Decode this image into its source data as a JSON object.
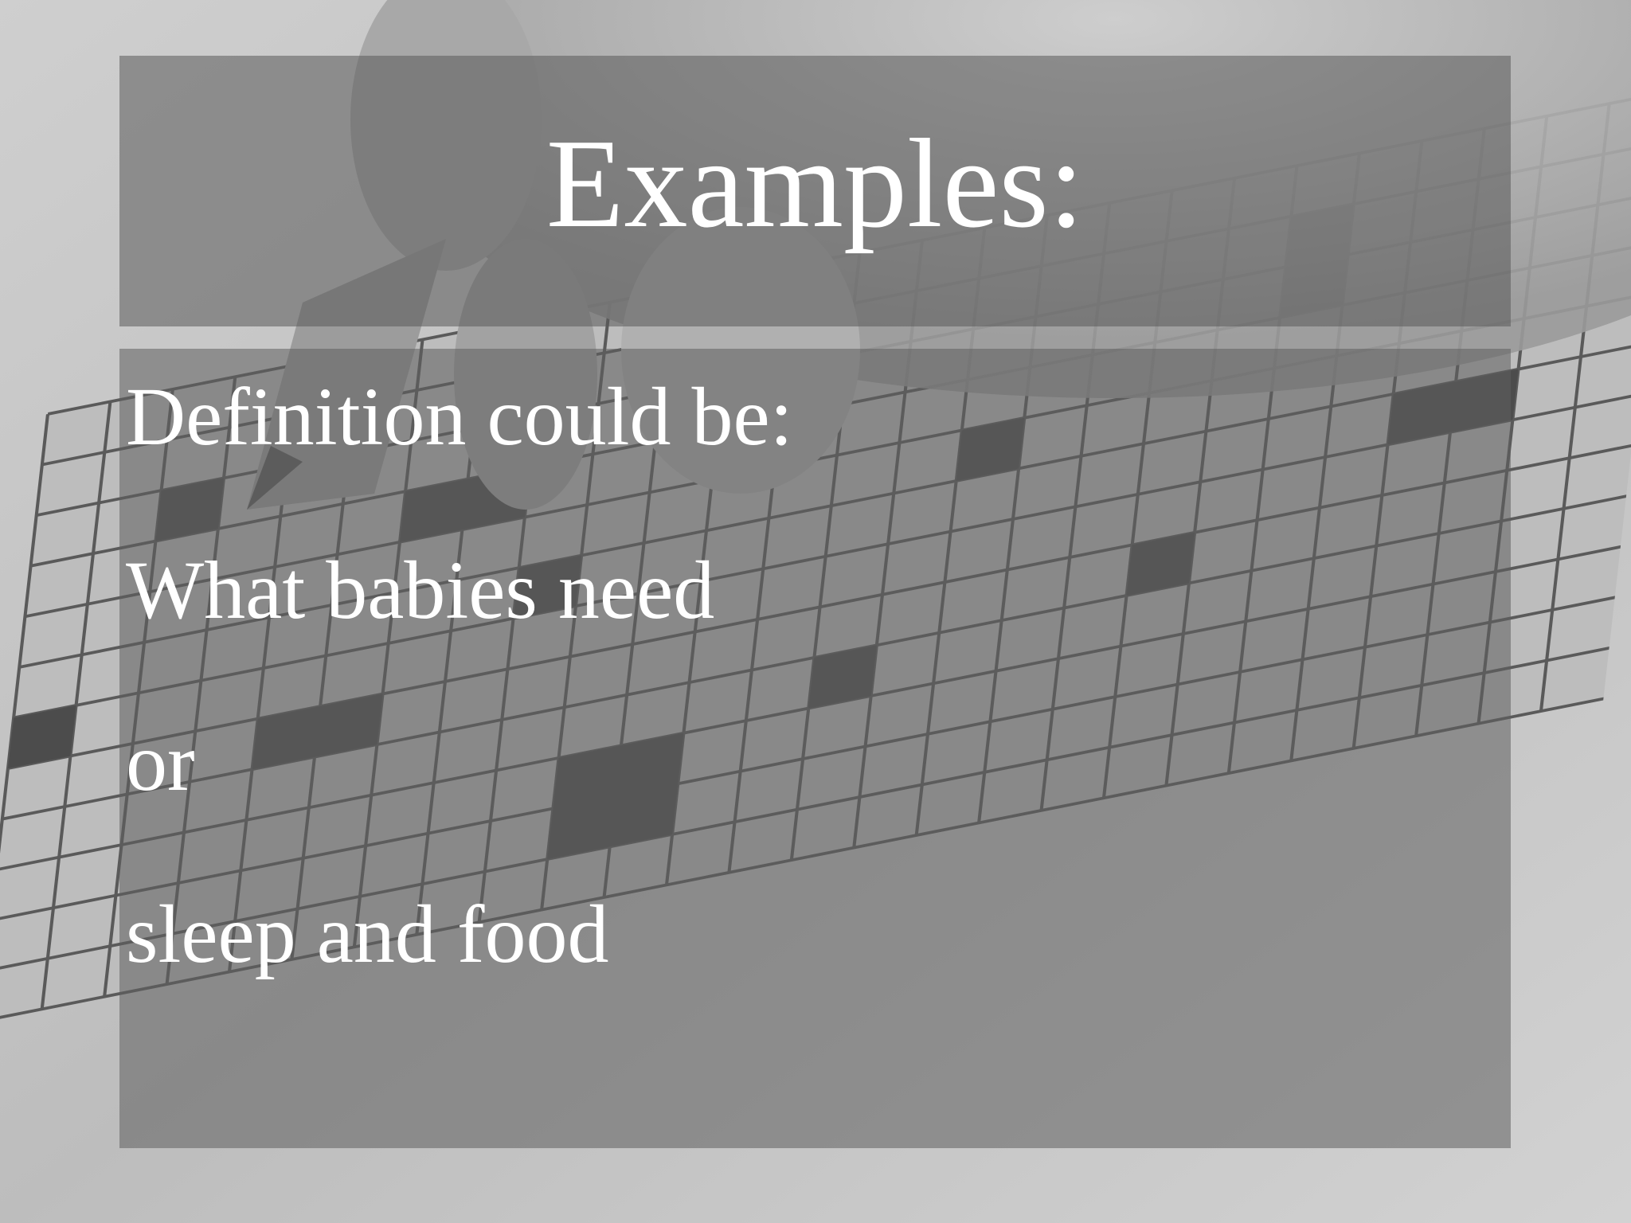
{
  "slide": {
    "title": "Examples:",
    "lines": [
      "Definition could be:",
      "What babies need",
      "or",
      "sleep and food"
    ]
  },
  "background": {
    "description_icon": "crossword-pencil-photo",
    "tone": "#bcbcbc"
  }
}
